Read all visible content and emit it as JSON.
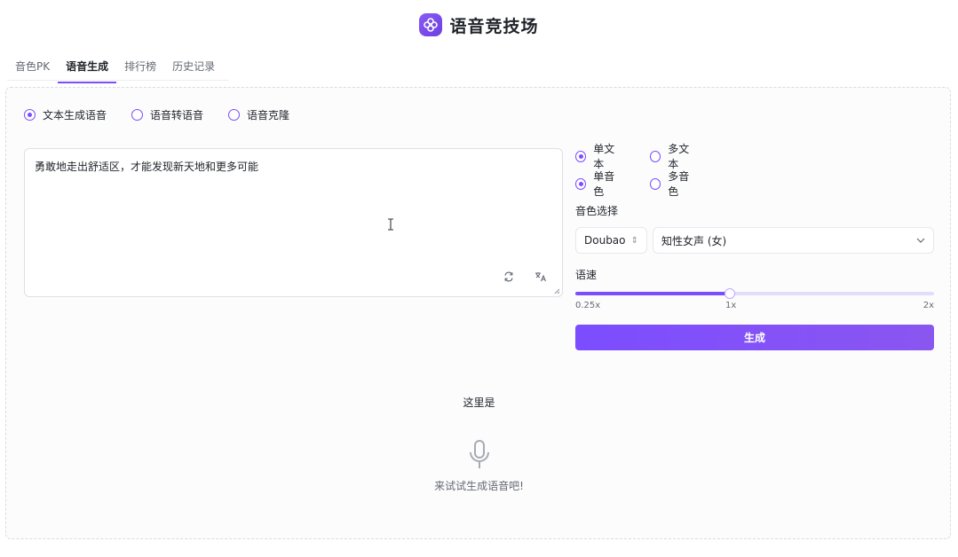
{
  "app": {
    "title": "语音竞技场",
    "logo_icon": "flower-logo-icon",
    "accent": "#7c4dff"
  },
  "tabs": [
    {
      "label": "音色PK",
      "active": false
    },
    {
      "label": "语音生成",
      "active": true
    },
    {
      "label": "排行榜",
      "active": false
    },
    {
      "label": "历史记录",
      "active": false
    }
  ],
  "mode": {
    "options": [
      "文本生成语音",
      "语音转语音",
      "语音克隆"
    ],
    "selected": 0
  },
  "input": {
    "value": "勇敢地走出舒适区，才能发现新天地和更多可能",
    "icons": [
      "refresh-icon",
      "translate-icon"
    ]
  },
  "settings": {
    "text_mode": {
      "options": [
        "单文本",
        "多文本"
      ],
      "selected": 0
    },
    "voice_mode": {
      "options": [
        "单音色",
        "多音色"
      ],
      "selected": 0
    },
    "voice_label": "音色选择",
    "provider_value": "Doubao",
    "voice_value": "知性女声 (女)",
    "speed_label": "语速",
    "speed": {
      "min_label": "0.25x",
      "mid_label": "1x",
      "max_label": "2x",
      "fraction": 0.43
    },
    "generate_label": "生成"
  },
  "output": {
    "tooltip": "这里是",
    "empty_text": "来试试生成语音吧!"
  }
}
